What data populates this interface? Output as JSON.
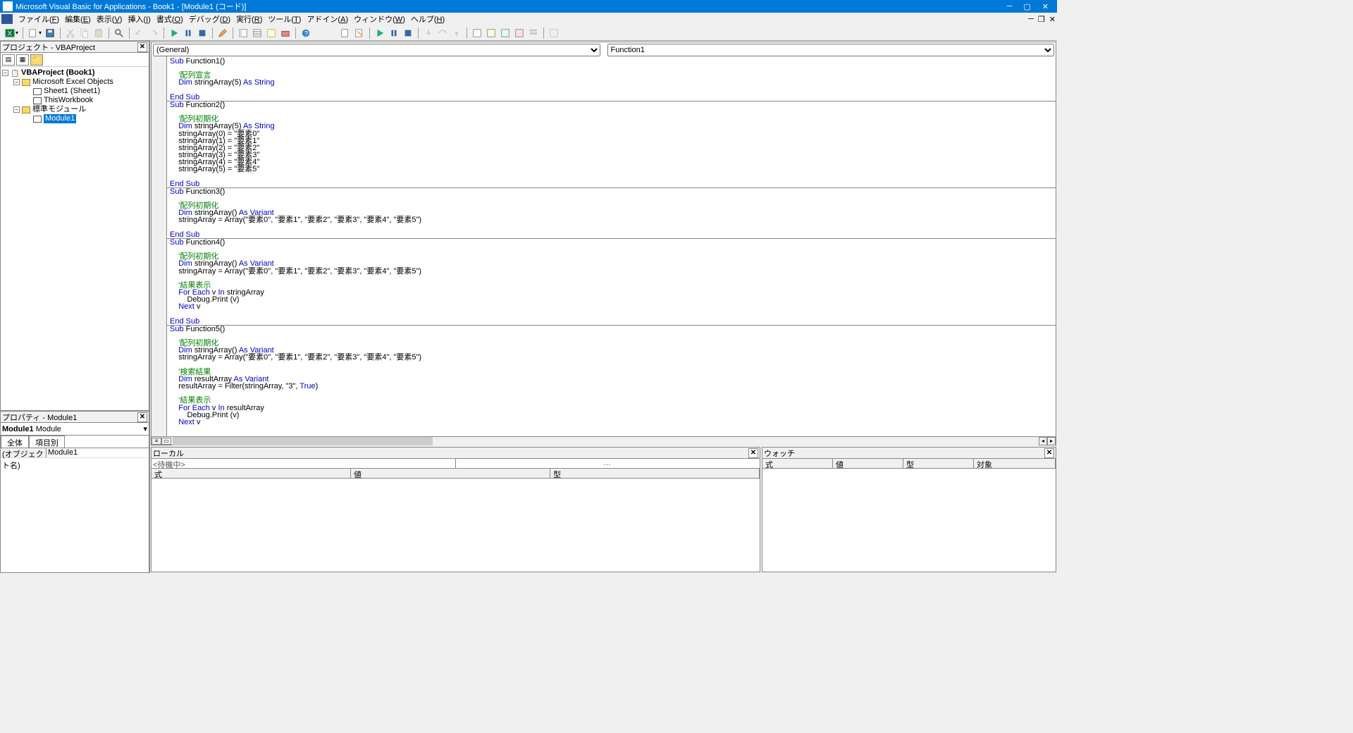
{
  "window": {
    "title": "Microsoft Visual Basic for Applications - Book1 - [Module1 (コード)]"
  },
  "menu": [
    {
      "label": "ファイル",
      "key": "F"
    },
    {
      "label": "編集",
      "key": "E"
    },
    {
      "label": "表示",
      "key": "V"
    },
    {
      "label": "挿入",
      "key": "I"
    },
    {
      "label": "書式",
      "key": "O"
    },
    {
      "label": "デバッグ",
      "key": "D"
    },
    {
      "label": "実行",
      "key": "R"
    },
    {
      "label": "ツール",
      "key": "T"
    },
    {
      "label": "アドイン",
      "key": "A"
    },
    {
      "label": "ウィンドウ",
      "key": "W"
    },
    {
      "label": "ヘルプ",
      "key": "H"
    }
  ],
  "project_panel": {
    "title": "プロジェクト - VBAProject",
    "root": "VBAProject (Book1)",
    "group1": "Microsoft Excel Objects",
    "sheet1": "Sheet1 (Sheet1)",
    "workbook": "ThisWorkbook",
    "group2": "標準モジュール",
    "module1": "Module1"
  },
  "properties_panel": {
    "title": "プロパティ - Module1",
    "object": "Module1",
    "objtype": "Module",
    "tab_all": "全体",
    "tab_cat": "項目別",
    "prop_key": "(オブジェクト名)",
    "prop_val": "Module1"
  },
  "code": {
    "dropdown_left": "(General)",
    "dropdown_right": "Function1",
    "lines": [
      {
        "t": "Sub Function1()",
        "kw": [
          "Sub"
        ]
      },
      {
        "t": ""
      },
      {
        "t": "    '配列宣言",
        "cm": true
      },
      {
        "t": "    Dim stringArray(5) As String",
        "kw": [
          "Dim",
          "As String"
        ]
      },
      {
        "t": ""
      },
      {
        "t": "End Sub",
        "kw": [
          "End Sub"
        ],
        "hr": true
      },
      {
        "t": "Sub Function2()",
        "kw": [
          "Sub"
        ]
      },
      {
        "t": ""
      },
      {
        "t": "    '配列初期化",
        "cm": true
      },
      {
        "t": "    Dim stringArray(5) As String",
        "kw": [
          "Dim",
          "As String"
        ]
      },
      {
        "t": "    stringArray(0) = \"要素0\""
      },
      {
        "t": "    stringArray(1) = \"要素1\""
      },
      {
        "t": "    stringArray(2) = \"要素2\""
      },
      {
        "t": "    stringArray(3) = \"要素3\""
      },
      {
        "t": "    stringArray(4) = \"要素4\""
      },
      {
        "t": "    stringArray(5) = \"要素5\""
      },
      {
        "t": ""
      },
      {
        "t": "End Sub",
        "kw": [
          "End Sub"
        ],
        "hr": true
      },
      {
        "t": "Sub Function3()",
        "kw": [
          "Sub"
        ]
      },
      {
        "t": ""
      },
      {
        "t": "    '配列初期化",
        "cm": true
      },
      {
        "t": "    Dim stringArray() As Variant",
        "kw": [
          "Dim",
          "As Variant"
        ]
      },
      {
        "t": "    stringArray = Array(\"要素0\", \"要素1\", \"要素2\", \"要素3\", \"要素4\", \"要素5\")"
      },
      {
        "t": ""
      },
      {
        "t": "End Sub",
        "kw": [
          "End Sub"
        ],
        "hr": true
      },
      {
        "t": "Sub Function4()",
        "kw": [
          "Sub"
        ]
      },
      {
        "t": ""
      },
      {
        "t": "    '配列初期化",
        "cm": true
      },
      {
        "t": "    Dim stringArray() As Variant",
        "kw": [
          "Dim",
          "As Variant"
        ]
      },
      {
        "t": "    stringArray = Array(\"要素0\", \"要素1\", \"要素2\", \"要素3\", \"要素4\", \"要素5\")"
      },
      {
        "t": ""
      },
      {
        "t": "    '結果表示",
        "cm": true
      },
      {
        "t": "    For Each v In stringArray",
        "kw": [
          "For Each",
          "In"
        ]
      },
      {
        "t": "        Debug.Print (v)"
      },
      {
        "t": "    Next v",
        "kw": [
          "Next"
        ]
      },
      {
        "t": ""
      },
      {
        "t": "End Sub",
        "kw": [
          "End Sub"
        ],
        "hr": true
      },
      {
        "t": "Sub Function5()",
        "kw": [
          "Sub"
        ]
      },
      {
        "t": ""
      },
      {
        "t": "    '配列初期化",
        "cm": true
      },
      {
        "t": "    Dim stringArray() As Variant",
        "kw": [
          "Dim",
          "As Variant"
        ]
      },
      {
        "t": "    stringArray = Array(\"要素0\", \"要素1\", \"要素2\", \"要素3\", \"要素4\", \"要素5\")"
      },
      {
        "t": ""
      },
      {
        "t": "    '検索結果",
        "cm": true
      },
      {
        "t": "    Dim resultArray As Variant",
        "kw": [
          "Dim",
          "As Variant"
        ]
      },
      {
        "t": "    resultArray = Filter(stringArray, \"3\", True)",
        "kw": [
          "True"
        ]
      },
      {
        "t": ""
      },
      {
        "t": "    '結果表示",
        "cm": true
      },
      {
        "t": "    For Each v In resultArray",
        "kw": [
          "For Each",
          "In"
        ]
      },
      {
        "t": "        Debug.Print (v)"
      },
      {
        "t": "    Next v",
        "kw": [
          "Next"
        ]
      }
    ]
  },
  "locals": {
    "title": "ローカル",
    "status": "<待機中>",
    "col_expr": "式",
    "col_value": "値",
    "col_type": "型"
  },
  "watch": {
    "title": "ウォッチ",
    "col_expr": "式",
    "col_value": "値",
    "col_type": "型",
    "col_context": "対象"
  }
}
